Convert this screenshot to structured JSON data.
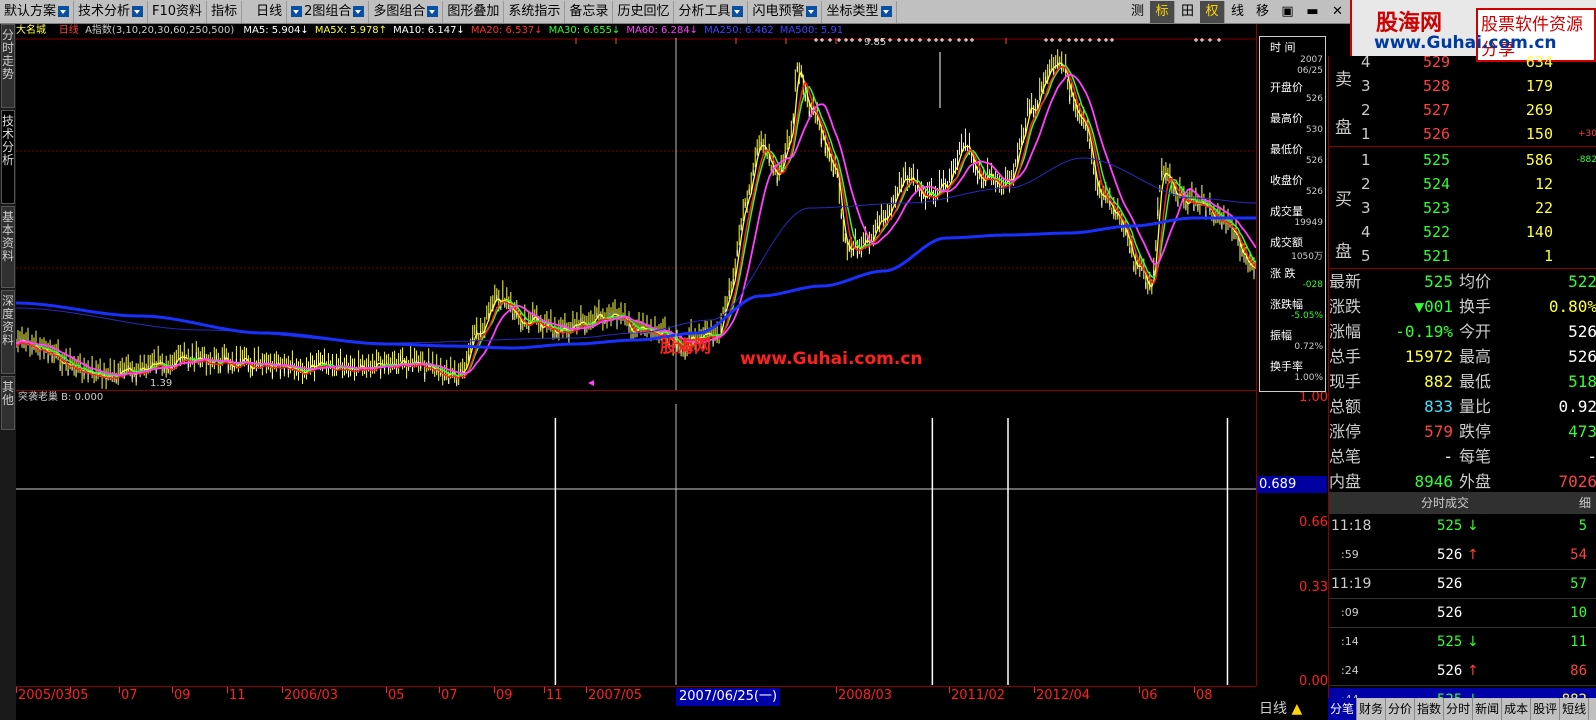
{
  "toolbar": {
    "items": [
      "默认方案",
      "技术分析",
      "F10资料",
      "指标",
      "日线",
      "2图组合",
      "多图组合",
      "图形叠加",
      "系统指示",
      "备忘录",
      "历史回忆",
      "分析工具",
      "闪电预警",
      "坐标类型"
    ],
    "right": [
      "测",
      "标",
      "田",
      "权",
      "线",
      "移",
      "窗口",
      "最小化",
      "关闭"
    ]
  },
  "logo": {
    "cn": "股海网",
    "slogan": "股票软件资源分享",
    "url": "www.Guhai.com.cn"
  },
  "left_tabs": [
    "分时走势",
    "技术分析",
    "基本资料",
    "深度资料",
    "其他"
  ],
  "header": {
    "stock_name": "大名城",
    "period": "日线",
    "indicator_name": "A指数(3,10,20,30,60,250,500)",
    "ma": [
      {
        "label": "MA5: 5.904↓",
        "color": "#ffffff"
      },
      {
        "label": "MA5X: 5.978↑",
        "color": "#ffff40"
      },
      {
        "label": "MA10: 6.147↓",
        "color": "#ffffff"
      },
      {
        "label": "MA20: 6.537↓",
        "color": "#ff3030"
      },
      {
        "label": "MA30: 6.655↓",
        "color": "#30ff30"
      },
      {
        "label": "MA60: 6.284↓",
        "color": "#ff40ff"
      },
      {
        "label": "MA250: 6.462",
        "color": "#4040ff"
      },
      {
        "label": "MA500: 5.91",
        "color": "#4040ff"
      }
    ]
  },
  "chart": {
    "low_label": "1.39",
    "high_label": "9.85",
    "watermark_cn": "股海网",
    "watermark_url": "www.Guhai.com.cn",
    "colors": {
      "yellow": "#ffff40",
      "red": "#ff2020",
      "green": "#30ff30",
      "magenta": "#ff40ff",
      "blue": "#1a30ff"
    }
  },
  "indicator": {
    "label": "突袭老巢 B: 0.000",
    "axis": [
      "1.00",
      "0.66",
      "0.33",
      "0.00"
    ],
    "cursor_value": "0.689",
    "signals": [
      0.435,
      0.739,
      0.8,
      0.977
    ]
  },
  "date_axis": {
    "labels": [
      "2005/03",
      "05",
      "07",
      "09",
      "11",
      "2006/03",
      "05",
      "07",
      "09",
      "11",
      "2007/05",
      "2008/03",
      "2011/02",
      "2012/04",
      "06",
      "08"
    ],
    "cursor": "2007/06/25(一)"
  },
  "data_panel": {
    "time_label": "时 间",
    "date": "2007",
    "date2": "06/25",
    "rows": [
      {
        "label": "开盘价",
        "value": "526"
      },
      {
        "label": "最高价",
        "value": "530"
      },
      {
        "label": "最低价",
        "value": "526"
      },
      {
        "label": "收盘价",
        "value": "526"
      },
      {
        "label": "成交量",
        "value": "19949"
      },
      {
        "label": "成交额",
        "value": "1050万"
      },
      {
        "label": "涨 跌",
        "value": "-028"
      },
      {
        "label": "涨跌幅",
        "value": "-5.05%"
      },
      {
        "label": "振幅",
        "value": "0.72%"
      },
      {
        "label": "换手率",
        "value": "1.00%"
      }
    ]
  },
  "orderbook": {
    "sell_label": [
      "卖",
      "盘"
    ],
    "buy_label": [
      "买",
      "盘"
    ],
    "sell": [
      {
        "lvl": "4",
        "price": "529",
        "vol": "634",
        "chg": ""
      },
      {
        "lvl": "3",
        "price": "528",
        "vol": "179",
        "chg": ""
      },
      {
        "lvl": "2",
        "price": "527",
        "vol": "269",
        "chg": ""
      },
      {
        "lvl": "1",
        "price": "526",
        "vol": "150",
        "chg": "+30"
      }
    ],
    "buy": [
      {
        "lvl": "1",
        "price": "525",
        "vol": "586",
        "chg": "-882"
      },
      {
        "lvl": "2",
        "price": "524",
        "vol": "12",
        "chg": ""
      },
      {
        "lvl": "3",
        "price": "523",
        "vol": "22",
        "chg": ""
      },
      {
        "lvl": "4",
        "price": "522",
        "vol": "140",
        "chg": ""
      },
      {
        "lvl": "5",
        "price": "521",
        "vol": "1",
        "chg": ""
      }
    ]
  },
  "quote": [
    {
      "l1": "最新",
      "v1": "525",
      "c1": "dn",
      "l2": "均价",
      "v2": "522",
      "c2": "dn"
    },
    {
      "l1": "涨跌",
      "v1": "▼001",
      "c1": "dn",
      "l2": "换手",
      "v2": "0.80%",
      "c2": "yl"
    },
    {
      "l1": "涨幅",
      "v1": "-0.19%",
      "c1": "dn",
      "l2": "今开",
      "v2": "526",
      "c2": "wh"
    },
    {
      "l1": "总手",
      "v1": "15972",
      "c1": "yl",
      "l2": "最高",
      "v2": "526",
      "c2": "wh"
    },
    {
      "l1": "现手",
      "v1": "882",
      "c1": "yl",
      "l2": "最低",
      "v2": "518",
      "c2": "dn"
    },
    {
      "l1": "总额",
      "v1": "833",
      "c1": "cy",
      "l2": "量比",
      "v2": "0.92",
      "c2": "wh"
    },
    {
      "l1": "涨停",
      "v1": "579",
      "c1": "up",
      "l2": "跌停",
      "v2": "473",
      "c2": "dn"
    },
    {
      "l1": "总笔",
      "v1": "-",
      "c1": "wh",
      "l2": "每笔",
      "v2": "-",
      "c2": "wh"
    },
    {
      "l1": "内盘",
      "v1": "8946",
      "c1": "dn",
      "l2": "外盘",
      "v2": "7026",
      "c2": "up"
    }
  ],
  "ticks": {
    "title": "分时成交",
    "detail": "细",
    "rows": [
      {
        "time": "11:18",
        "price": "525",
        "dir": "↓",
        "vol": "5",
        "pc": "dn",
        "vc": "dn"
      },
      {
        "time": ":59",
        "price": "526",
        "dir": "↑",
        "vol": "54",
        "pc": "wh",
        "vc": "up"
      },
      {
        "time": "11:19",
        "price": "526",
        "dir": "",
        "vol": "57",
        "pc": "wh",
        "vc": "dn"
      },
      {
        "time": ":09",
        "price": "526",
        "dir": "",
        "vol": "10",
        "pc": "wh",
        "vc": "dn"
      },
      {
        "time": ":14",
        "price": "525",
        "dir": "↓",
        "vol": "11",
        "pc": "dn",
        "vc": "dn"
      },
      {
        "time": ":24",
        "price": "526",
        "dir": "↑",
        "vol": "86",
        "pc": "wh",
        "vc": "up"
      },
      {
        "time": ":44",
        "price": "525",
        "dir": "↓",
        "vol": "882",
        "pc": "dn",
        "vc": "yl"
      }
    ]
  },
  "bottom_tabs": {
    "left": "日线",
    "tabs": [
      "分笔",
      "财务",
      "分价",
      "指数",
      "分时",
      "新闻",
      "成本",
      "股评",
      "短线"
    ]
  }
}
